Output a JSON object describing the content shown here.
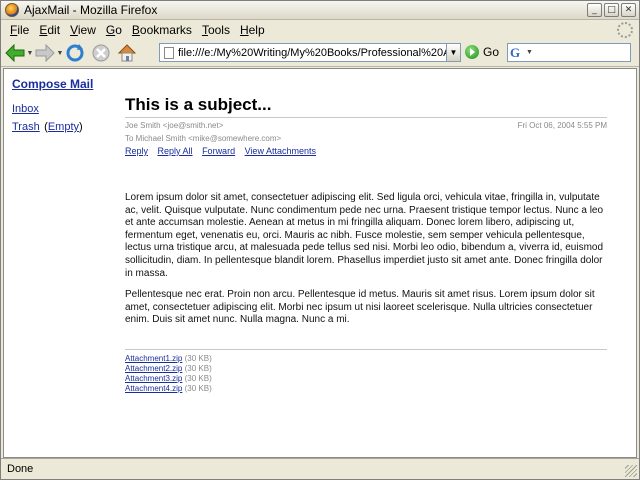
{
  "window": {
    "title": "AjaxMail - Mozilla Firefox"
  },
  "menu": [
    {
      "u": "F",
      "rest": "ile"
    },
    {
      "u": "E",
      "rest": "dit"
    },
    {
      "u": "V",
      "rest": "iew"
    },
    {
      "u": "G",
      "rest": "o"
    },
    {
      "u": "B",
      "rest": "ookmarks"
    },
    {
      "u": "T",
      "rest": "ools"
    },
    {
      "u": "H",
      "rest": "elp"
    }
  ],
  "toolbar": {
    "url": "file:///e:/My%20Writing/My%20Books/Professional%20A...",
    "go_label": "Go"
  },
  "sidebar": {
    "compose": "Compose Mail",
    "inbox": "Inbox",
    "trash": "Trash",
    "empty_open": "(",
    "empty": "Empty",
    "empty_close": ")"
  },
  "message": {
    "subject": "This is a subject...",
    "from": "Joe Smith <joe@smith.net>",
    "date": "Fri Oct 06, 2004 5:55 PM",
    "to": "To Michael Smith <mike@somewhere.com>",
    "actions": [
      "Reply",
      "Reply All",
      "Forward",
      "View Attachments"
    ],
    "paragraphs": [
      "Lorem ipsum dolor sit amet, consectetuer adipiscing elit. Sed ligula orci, vehicula vitae, fringilla in, vulputate ac, velit. Quisque vulputate. Nunc condimentum pede nec urna. Praesent tristique tempor lectus. Nunc a leo et ante accumsan molestie. Aenean at metus in mi fringilla aliquam. Donec lorem libero, adipiscing ut, fermentum eget, venenatis eu, orci. Mauris ac nibh. Fusce molestie, sem semper vehicula pellentesque, lectus urna tristique arcu, at malesuada pede tellus sed nisi. Morbi leo odio, bibendum a, viverra id, euismod sollicitudin, diam. In pellentesque blandit lorem. Phasellus imperdiet justo sit amet ante. Donec fringilla dolor in massa.",
      "Pellentesque nec erat. Proin non arcu. Pellentesque id metus. Mauris sit amet risus. Lorem ipsum dolor sit amet, consectetuer adipiscing elit. Morbi nec ipsum ut nisi laoreet scelerisque. Nulla ultricies consectetuer enim. Duis sit amet nunc. Nulla magna. Nunc a mi."
    ],
    "attachments": [
      {
        "name": "Attachment1.zip",
        "size": "(30 KB)"
      },
      {
        "name": "Attachment2.zip",
        "size": "(30 KB)"
      },
      {
        "name": "Attachment3.zip",
        "size": "(30 KB)"
      },
      {
        "name": "Attachment4.zip",
        "size": "(30 KB)"
      }
    ]
  },
  "status": {
    "text": "Done"
  },
  "colors": {
    "link": "#1a2d9c",
    "meta_gray": "#8a8a8a",
    "chrome": "#ece9d8"
  },
  "icons": [
    "firefox-icon",
    "back-arrow-icon",
    "forward-arrow-icon",
    "reload-icon",
    "stop-icon",
    "home-icon",
    "page-icon",
    "go-icon",
    "google-search-icon",
    "throbber-icon"
  ]
}
